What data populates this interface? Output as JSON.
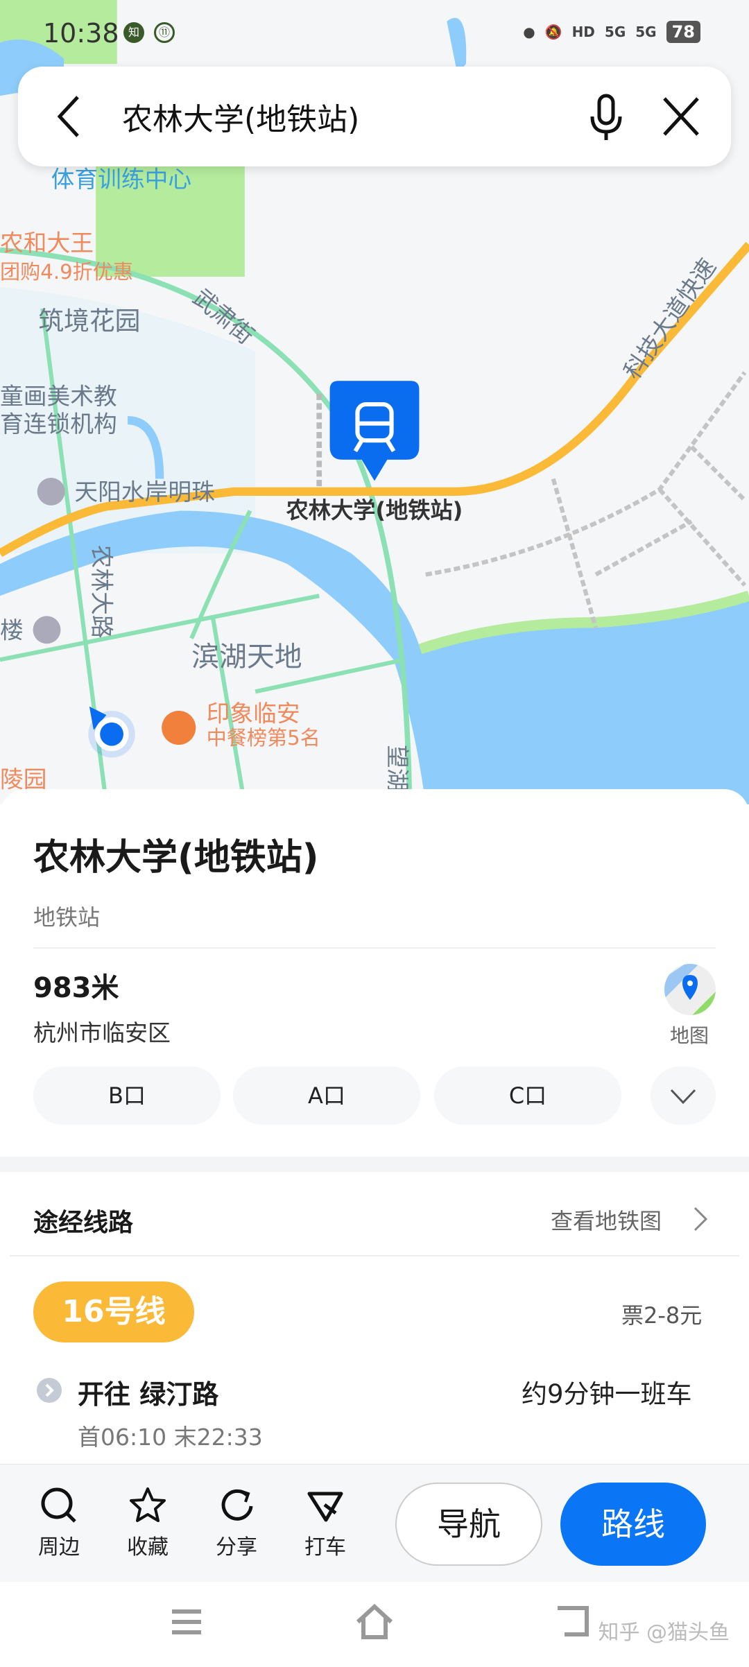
{
  "status_bar": {
    "time": "10:38",
    "notif_icons": [
      "zhihu-icon",
      "app-icon"
    ],
    "network": "5G",
    "battery": "78"
  },
  "search": {
    "query": "农林大学(地铁站)"
  },
  "map": {
    "marker_label": "农林大学(地铁站)",
    "labels": {
      "sports": "体育训练中心",
      "promo1": "农和大王",
      "promo2": "团购4.9折优惠",
      "wusu": "武肃街",
      "zhujing": "筑境花园",
      "art1": "童画美术教",
      "art2": "育连锁机构",
      "tianyang": "天阳水岸明珠",
      "nonglin_road": "农林大路",
      "lou": "楼",
      "binhu": "滨湖天地",
      "rest1": "印象临安",
      "rest2": "中餐榜第5名",
      "keji": "科技大道快速",
      "wanghu": "望湖",
      "lingyuan": "陵园"
    },
    "colors": {
      "water": "#8ecdfb",
      "park": "#b4eb9d",
      "highway": "#fbb938",
      "road": "#8be0b4",
      "land": "#f4f6f8",
      "marker": "#0a6df0"
    }
  },
  "place": {
    "name": "农林大学(地铁站)",
    "category": "地铁站",
    "distance": "983米",
    "district": "杭州市临安区",
    "map_label": "地图",
    "exits": [
      "B口",
      "A口",
      "C口"
    ]
  },
  "lines": {
    "section_title": "途经线路",
    "view_map": "查看地铁图",
    "line_name": "16号线",
    "line_color": "#fbb938",
    "fare": "票2-8元",
    "direction": "开往 绿汀路",
    "frequency": "约9分钟一班车",
    "first_last": "首06:10  末22:33"
  },
  "actions": {
    "nearby": "周边",
    "favorite": "收藏",
    "share": "分享",
    "taxi": "打车",
    "navigate": "导航",
    "route": "路线",
    "route_color": "#0a76f5"
  },
  "watermark": "知乎 @猫头鱼"
}
